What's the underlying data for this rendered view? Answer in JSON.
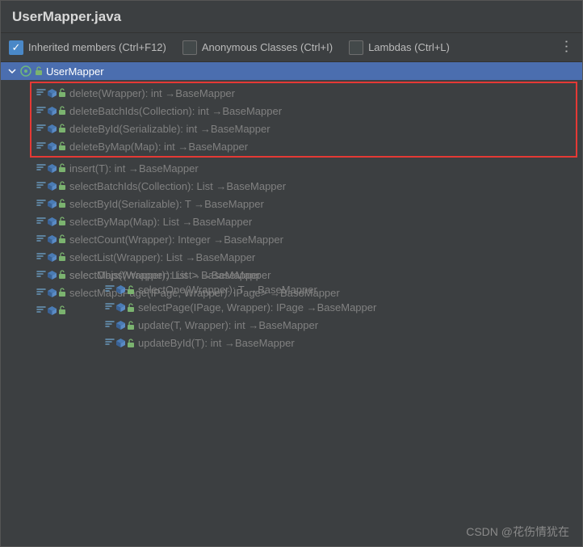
{
  "title": "UserMapper.java",
  "toolbar": {
    "inherited": {
      "label": "Inherited members (Ctrl+F12)",
      "checked": true
    },
    "anonymous": {
      "label": "Anonymous Classes (Ctrl+I)",
      "checked": false
    },
    "lambdas": {
      "label": "Lambdas (Ctrl+L)",
      "checked": false
    }
  },
  "root": {
    "label": "UserMapper"
  },
  "highlighted_methods": [
    "delete(Wrapper<T>): int →BaseMapper",
    "deleteBatchIds(Collection<? extends Serializable>): int →BaseMapper",
    "deleteById(Serializable): int →BaseMapper",
    "deleteByMap(Map<String, Object>): int →BaseMapper"
  ],
  "methods": [
    "insert(T): int →BaseMapper",
    "selectBatchIds(Collection<? extends Serializable>): List<T> →BaseMapper",
    "selectById(Serializable): T →BaseMapper",
    "selectByMap(Map<String, Object>): List<T> →BaseMapper",
    "selectCount(Wrapper<T>): Integer →BaseMapper",
    "selectList(Wrapper<T>): List<T> →BaseMapper",
    "selectMaps(Wrapper<T>): List<Map<String, Object>> →BaseMapper",
    "selectMapsPage(IPage<T>, Wrapper<T>): IPage<Map<String, Object>> →BaseMapper",
    "selectObjs(Wrapper<T>): List<Object> →BaseMapper",
    "selectOne(Wrapper<T>): T →BaseMapper",
    "selectPage(IPage<T>, Wrapper<T>): IPage<T> →BaseMapper",
    "update(T, Wrapper<T>): int →BaseMapper",
    "updateById(T): int →BaseMapper"
  ],
  "watermark": "CSDN @花伤情犹在"
}
